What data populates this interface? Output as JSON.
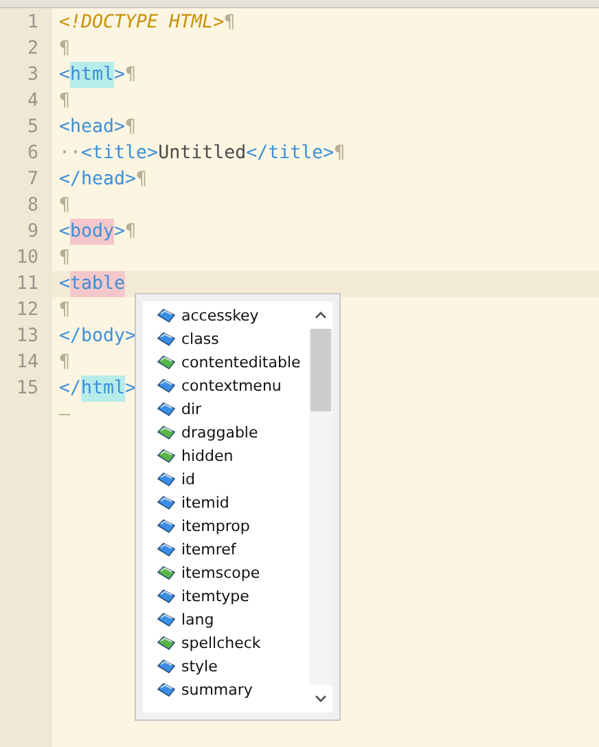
{
  "editor": {
    "lines": [
      {
        "number": "1",
        "current": false,
        "tokens": [
          {
            "kind": "doctype",
            "text": "<!DOCTYPE HTML>"
          }
        ],
        "eol": "¶"
      },
      {
        "number": "2",
        "current": false,
        "eol": "¶"
      },
      {
        "number": "3",
        "current": false,
        "tokens": [
          {
            "kind": "punct",
            "text": "<"
          },
          {
            "kind": "match",
            "text": "html"
          },
          {
            "kind": "punct",
            "text": ">"
          }
        ],
        "eol": "¶"
      },
      {
        "number": "4",
        "current": false,
        "eol": "¶"
      },
      {
        "number": "5",
        "current": false,
        "tokens": [
          {
            "kind": "tag",
            "text": "<head>"
          }
        ],
        "eol": "¶"
      },
      {
        "number": "6",
        "current": false,
        "tokens": [
          {
            "kind": "space",
            "text": "··"
          },
          {
            "kind": "tag",
            "text": "<title>"
          },
          {
            "kind": "text",
            "text": "Untitled"
          },
          {
            "kind": "tag",
            "text": "</title>"
          }
        ],
        "eol": "¶"
      },
      {
        "number": "7",
        "current": false,
        "tokens": [
          {
            "kind": "tag",
            "text": "</head>"
          }
        ],
        "eol": "¶"
      },
      {
        "number": "8",
        "current": false,
        "eol": "¶"
      },
      {
        "number": "9",
        "current": false,
        "tokens": [
          {
            "kind": "punct",
            "text": "<"
          },
          {
            "kind": "error",
            "text": "body"
          },
          {
            "kind": "punct",
            "text": ">"
          }
        ],
        "eol": "¶"
      },
      {
        "number": "10",
        "current": false,
        "eol": "¶"
      },
      {
        "number": "11",
        "current": true,
        "tokens": [
          {
            "kind": "punct",
            "text": "<"
          },
          {
            "kind": "error",
            "text": "table"
          }
        ]
      },
      {
        "number": "12",
        "current": false,
        "eol": "¶"
      },
      {
        "number": "13",
        "current": false,
        "tokens": [
          {
            "kind": "tag",
            "text": "</body>"
          }
        ]
      },
      {
        "number": "14",
        "current": false,
        "eol": "¶"
      },
      {
        "number": "15",
        "current": false,
        "tokens": [
          {
            "kind": "punct",
            "text": "</"
          },
          {
            "kind": "match",
            "text": "html"
          },
          {
            "kind": "punct",
            "text": ">"
          }
        ]
      }
    ],
    "eof_mark": "—"
  },
  "autocomplete": {
    "items": [
      {
        "label": "accesskey",
        "color": "#3a8ee6",
        "selected": false
      },
      {
        "label": "class",
        "color": "#3a8ee6",
        "selected": false
      },
      {
        "label": "contenteditable",
        "color": "#58b548",
        "selected": false
      },
      {
        "label": "contextmenu",
        "color": "#3a8ee6",
        "selected": false
      },
      {
        "label": "dir",
        "color": "#3a8ee6",
        "selected": false
      },
      {
        "label": "draggable",
        "color": "#58b548",
        "selected": false
      },
      {
        "label": "hidden",
        "color": "#58b548",
        "selected": false
      },
      {
        "label": "id",
        "color": "#3a8ee6",
        "selected": false
      },
      {
        "label": "itemid",
        "color": "#3a8ee6",
        "selected": false
      },
      {
        "label": "itemprop",
        "color": "#3a8ee6",
        "selected": false
      },
      {
        "label": "itemref",
        "color": "#3a8ee6",
        "selected": false
      },
      {
        "label": "itemscope",
        "color": "#58b548",
        "selected": false
      },
      {
        "label": "itemtype",
        "color": "#3a8ee6",
        "selected": false
      },
      {
        "label": "lang",
        "color": "#3a8ee6",
        "selected": false
      },
      {
        "label": "spellcheck",
        "color": "#58b548",
        "selected": false
      },
      {
        "label": "style",
        "color": "#3a8ee6",
        "selected": false
      },
      {
        "label": "summary",
        "color": "#3a8ee6",
        "selected": false
      }
    ]
  }
}
